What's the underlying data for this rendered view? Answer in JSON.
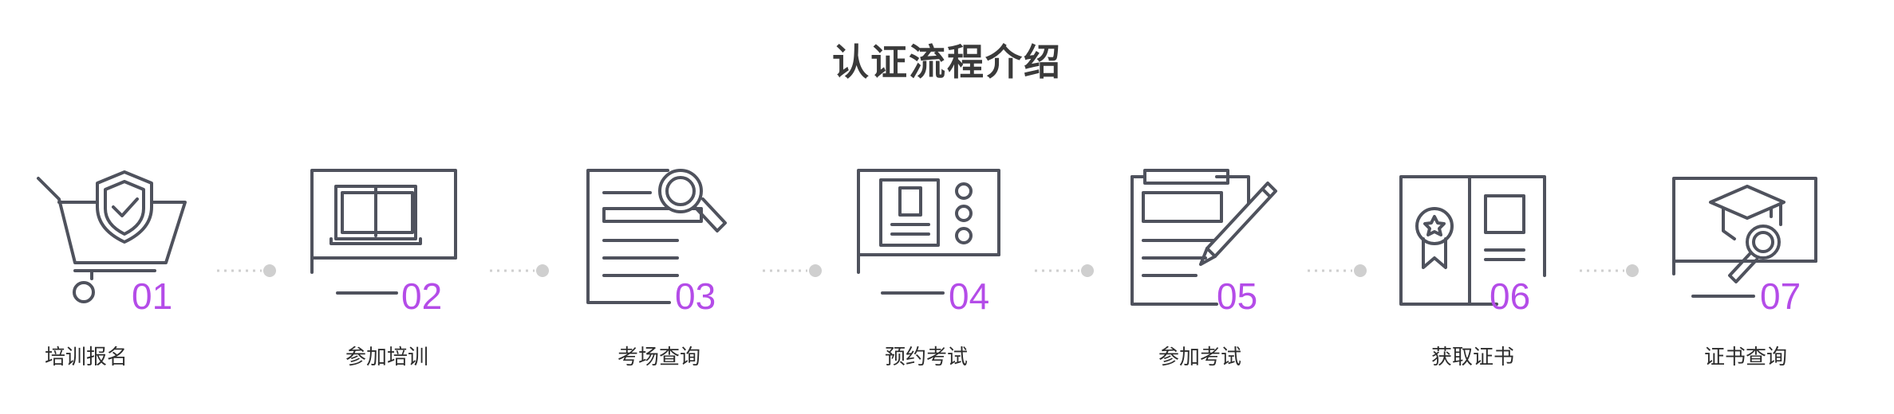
{
  "title": "认证流程介绍",
  "accent_color": "#b44ce8",
  "icon_color": "#4f525d",
  "steps": [
    {
      "number": "01",
      "label": "培训报名",
      "icon": "cart-shield-icon"
    },
    {
      "number": "02",
      "label": "参加培训",
      "icon": "book-screen-icon"
    },
    {
      "number": "03",
      "label": "考场查询",
      "icon": "document-search-icon"
    },
    {
      "number": "04",
      "label": "预约考试",
      "icon": "id-card-screen-icon"
    },
    {
      "number": "05",
      "label": "参加考试",
      "icon": "clipboard-pen-icon"
    },
    {
      "number": "06",
      "label": "获取证书",
      "icon": "certificate-icon"
    },
    {
      "number": "07",
      "label": "证书查询",
      "icon": "grad-cap-search-icon"
    }
  ]
}
